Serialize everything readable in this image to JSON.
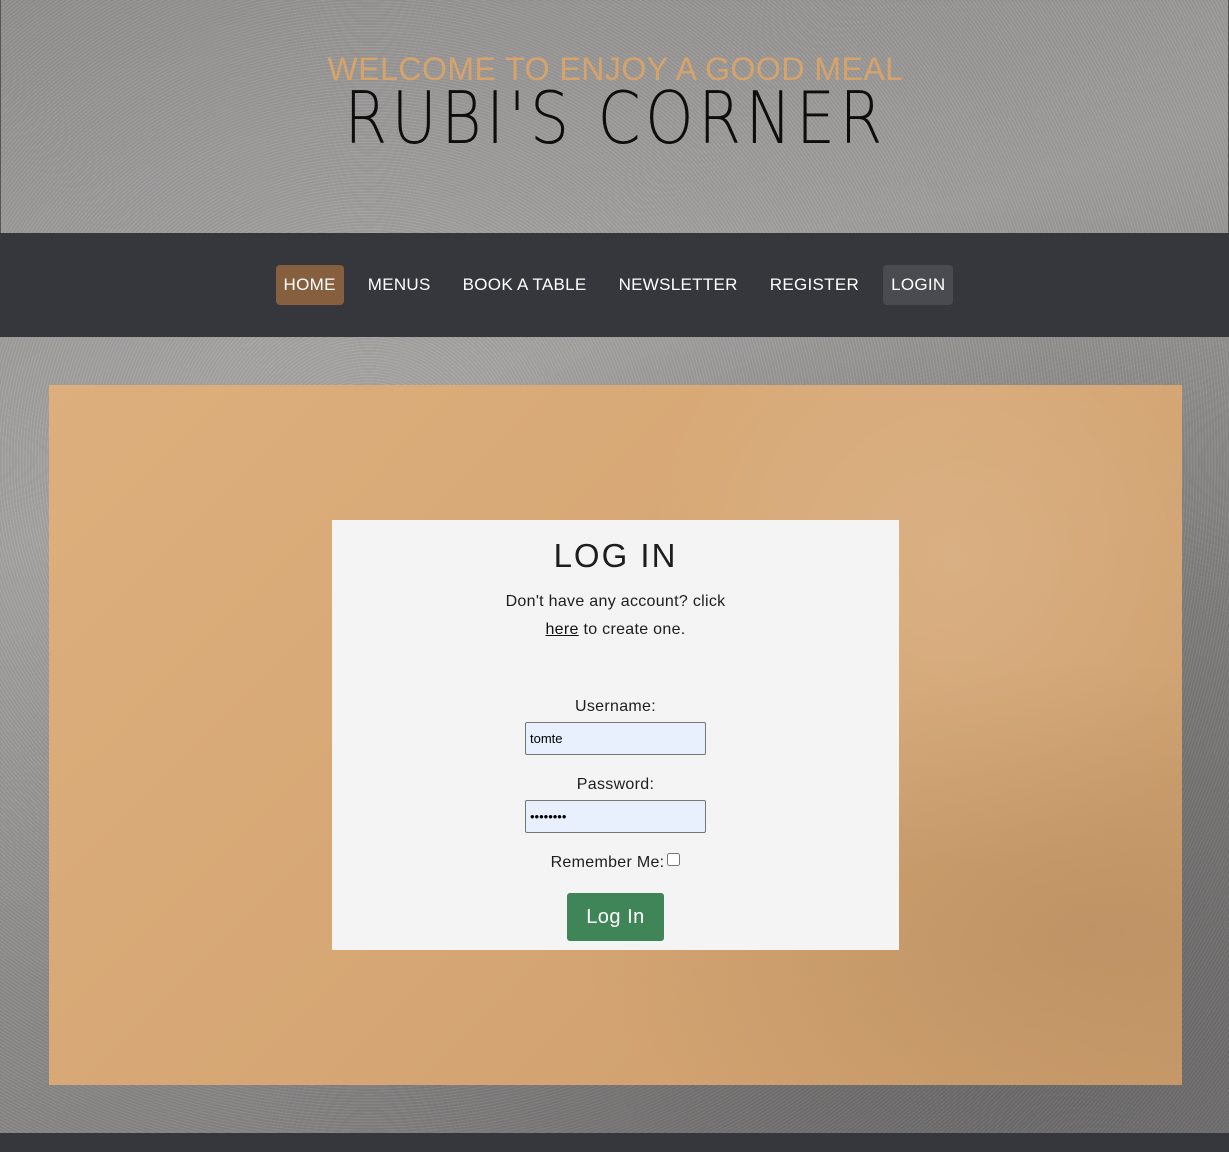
{
  "header": {
    "tagline": "WELCOME TO ENJOY A GOOD MEAL",
    "brand": "RUBI'S CORNER"
  },
  "nav": {
    "items": [
      {
        "label": "HOME",
        "state": "active"
      },
      {
        "label": "MENUS",
        "state": ""
      },
      {
        "label": "BOOK A TABLE",
        "state": ""
      },
      {
        "label": "NEWSLETTER",
        "state": ""
      },
      {
        "label": "REGISTER",
        "state": ""
      },
      {
        "label": "LOGIN",
        "state": "current"
      }
    ]
  },
  "login": {
    "title": "LOG IN",
    "prompt_before": "Don't have any account? click",
    "prompt_link": "here",
    "prompt_after": "to create one.",
    "username_label": "Username:",
    "username_value": "tomte",
    "password_label": "Password:",
    "password_value": "••••••••",
    "remember_label": "Remember Me:",
    "remember_checked": false,
    "submit_label": "Log In"
  },
  "colors": {
    "accent": "#d6a36a",
    "nav_bg": "#36373d",
    "nav_active": "#86603e",
    "button": "#3f8558",
    "panel": "#d9ab78"
  }
}
